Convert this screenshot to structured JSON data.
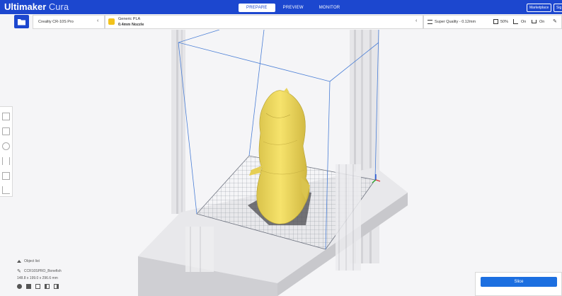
{
  "app": {
    "name_bold": "Ultimaker",
    "name_light": "Cura"
  },
  "stages": [
    {
      "label": "PREPARE",
      "active": true
    },
    {
      "label": "PREVIEW",
      "active": false
    },
    {
      "label": "MONITOR",
      "active": false
    }
  ],
  "header": {
    "marketplace_label": "Marketplace",
    "signin_label": "Sig"
  },
  "printer": {
    "name": "Creality CR-10S Pro"
  },
  "material": {
    "name": "Generic PLA",
    "nozzle": "0.4mm Nozzle"
  },
  "print_settings": {
    "profile": "Super Quality - 0.12mm",
    "infill": "50%",
    "support": "On",
    "adhesion": "On"
  },
  "object_list": {
    "title": "Object list",
    "filename": "CCR10SPRO_Bonefish",
    "dimensions": "148.8 x 199.0 x 296.6 mm"
  },
  "slice": {
    "label": "Slice"
  },
  "colors": {
    "accent": "#1c47cf",
    "model": "#f2dc5d",
    "slice_button": "#1c6fe0"
  },
  "icons": [
    "open-file-icon",
    "chevron-left-icon",
    "material-icon",
    "profile-icon",
    "infill-icon",
    "support-icon",
    "adhesion-icon",
    "pencil-icon",
    "move-icon",
    "scale-icon",
    "rotate-icon",
    "mirror-icon",
    "per-model-settings-icon",
    "support-blocker-icon"
  ]
}
